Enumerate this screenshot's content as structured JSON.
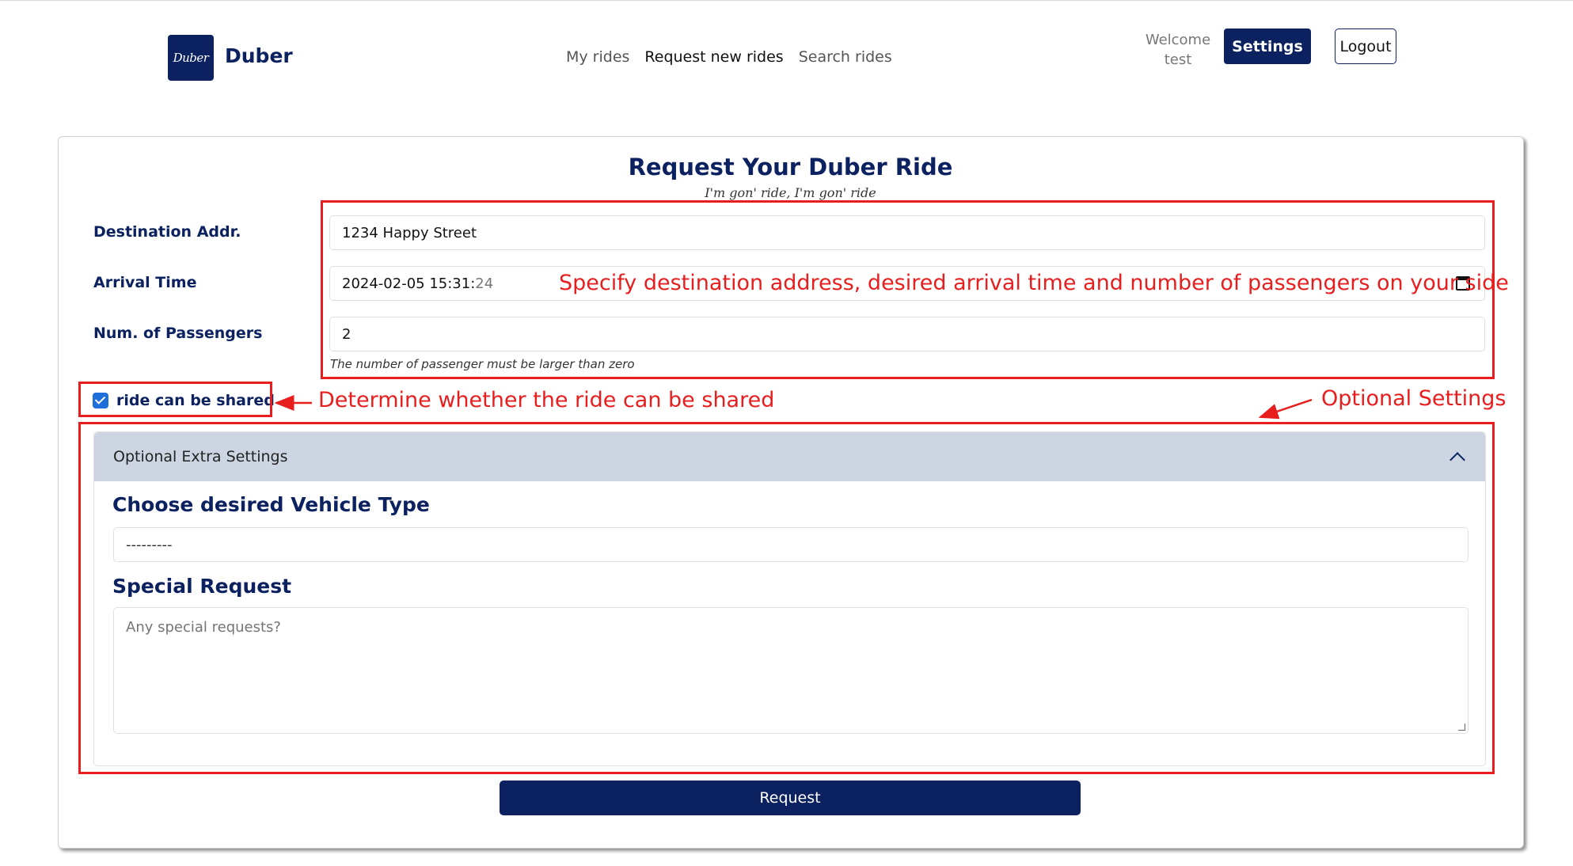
{
  "navbar": {
    "logo_text": "Duber",
    "brand_name": "Duber",
    "links": [
      {
        "label": "My rides",
        "active": false
      },
      {
        "label": "Request new rides",
        "active": true
      },
      {
        "label": "Search rides",
        "active": false
      }
    ],
    "welcome_label": "Welcome",
    "username": "test",
    "settings_label": "Settings",
    "logout_label": "Logout"
  },
  "form": {
    "title": "Request Your Duber Ride",
    "tagline": "I'm gon' ride, I'm gon' ride",
    "destination": {
      "label": "Destination Addr.",
      "value": "1234 Happy Street"
    },
    "arrival_time": {
      "label": "Arrival Time",
      "value_main": "2024-02-05 15:31:",
      "value_seconds": "24"
    },
    "passengers": {
      "label": "Num. of Passengers",
      "value": "2",
      "helper": "The number of passenger must be larger than zero"
    },
    "shared": {
      "label": "ride can be shared",
      "checked": true
    },
    "optional": {
      "header": "Optional Extra Settings",
      "vehicle_heading": "Choose desired Vehicle Type",
      "vehicle_value": "---------",
      "special_heading": "Special Request",
      "special_placeholder": "Any special requests?"
    },
    "submit_label": "Request"
  },
  "annotations": {
    "fields_note": "Specify destination address, desired arrival time and number of passengers on your side",
    "shared_note": "Determine whether the ride can be shared",
    "optional_note": "Optional Settings"
  },
  "colors": {
    "primary": "#0b2160",
    "accordion_header": "#cdd5e2",
    "annotation": "#e81e1e",
    "checkbox": "#1e6fd9"
  }
}
